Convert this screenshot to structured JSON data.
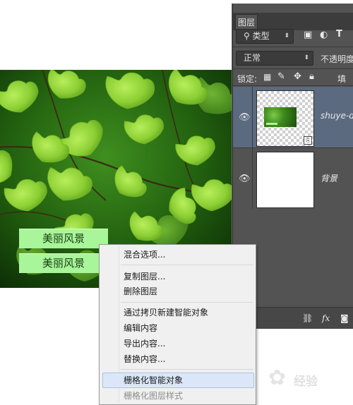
{
  "canvas": {
    "captions": [
      "美丽风景",
      "美丽风景"
    ]
  },
  "layers_panel": {
    "tab_label": "图层",
    "filter_label": "类型",
    "blend_mode": "正常",
    "opacity_label": "不透明度",
    "lock_label": "锁定:",
    "fill_label": "填充",
    "layers": [
      {
        "name": "shuye-de",
        "selected": true
      },
      {
        "name": "背景",
        "selected": false
      }
    ]
  },
  "context_menu": {
    "items": [
      {
        "label": "混合选项...",
        "enabled": true
      },
      {
        "label": "复制图层...",
        "enabled": true
      },
      {
        "label": "删除图层",
        "enabled": true
      },
      {
        "label": "通过拷贝新建智能对象",
        "enabled": true
      },
      {
        "label": "编辑内容",
        "enabled": true
      },
      {
        "label": "导出内容...",
        "enabled": true
      },
      {
        "label": "替换内容...",
        "enabled": true
      },
      {
        "label": "栅格化智能对象",
        "enabled": true,
        "highlighted": true
      },
      {
        "label": "栅格化图层样式",
        "enabled": false
      }
    ]
  },
  "watermark": {
    "text": "经验"
  },
  "colors": {
    "panel_bg": "#535353",
    "selected_layer": "#5c6a80",
    "caption_bg": "#a8f59a",
    "menu_bg": "#f0f0f0",
    "menu_highlight": "#dbe7f8"
  }
}
